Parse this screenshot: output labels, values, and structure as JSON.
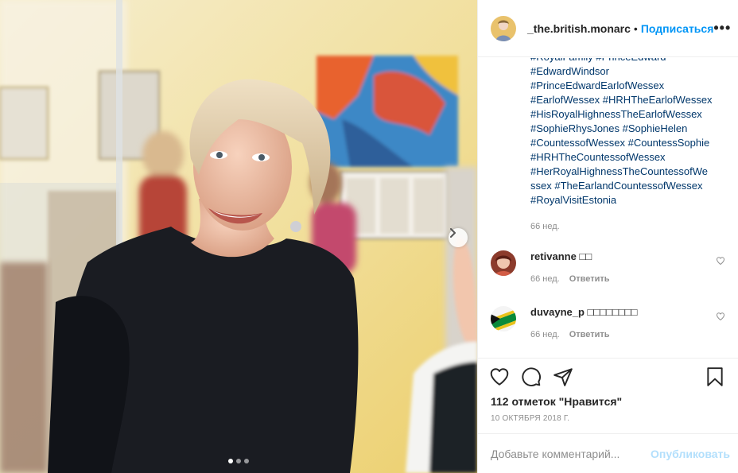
{
  "header": {
    "username": "_the.british.monarc",
    "separator": "•",
    "follow_label": "Подписаться",
    "more_label": "•••"
  },
  "caption": {
    "lines": [
      "#RoyalFamily #PrinceEdward",
      "#EdwardWindsor",
      "#PrinceEdwardEarlofWessex",
      "#EarlofWessex #HRHTheEarlofWessex",
      "#HisRoyalHighnessTheEarlofWessex",
      "#SophieRhysJones #SophieHelen",
      "#CountessofWessex #CountessSophie",
      "#HRHTheCountessofWessex",
      "#HerRoyalHighnessTheCountessofWe",
      "ssex #TheEarlandCountessofWessex",
      "#RoyalVisitEstonia"
    ],
    "time": "66 нед."
  },
  "comments": [
    {
      "username": "retivanne",
      "text": "□□",
      "time": "66 нед.",
      "reply_label": "Ответить"
    },
    {
      "username": "duvayne_p",
      "text": "□□□□□□□□",
      "time": "66 нед.",
      "reply_label": "Ответить"
    }
  ],
  "actions": {
    "icons": [
      "heart-icon",
      "comment-icon",
      "share-icon",
      "bookmark-icon"
    ],
    "likes": "112 отметок \"Нравится\"",
    "date": "10 ОКТЯБРЯ 2018 Г."
  },
  "add_comment": {
    "placeholder": "Добавьте комментарий...",
    "post_label": "Опубликовать"
  },
  "carousel": {
    "slide_count": 3,
    "active_index": 0
  },
  "colors": {
    "link": "#00376b",
    "accent": "#0095f6",
    "muted": "#8e8e8e",
    "post_disabled": "#b2dffc"
  }
}
